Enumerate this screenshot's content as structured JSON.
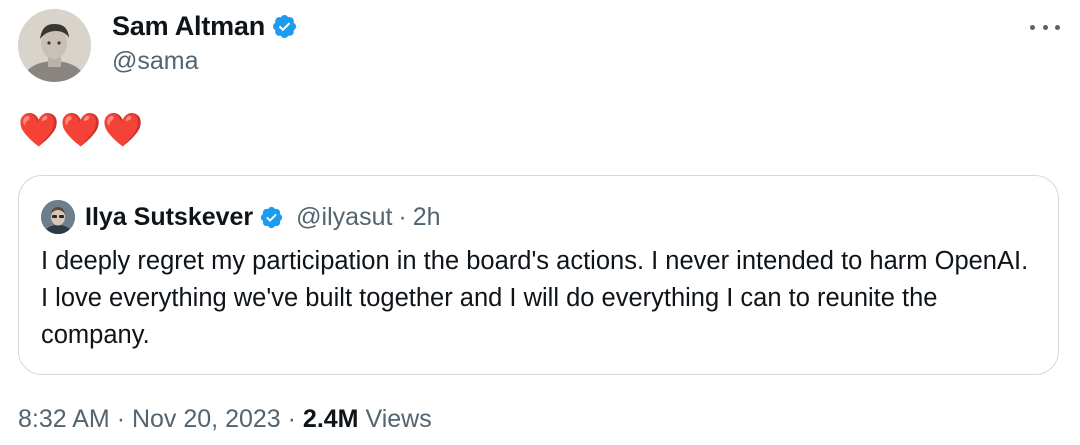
{
  "tweet": {
    "author": {
      "name": "Sam Altman",
      "handle": "@sama",
      "verified": true,
      "avatar": "profile-photo"
    },
    "text": "❤️❤️❤️",
    "more_icon": "ellipsis-horizontal-icon",
    "quote": {
      "author": {
        "name": "Ilya Sutskever",
        "handle": "@ilyasut",
        "verified": true,
        "avatar": "profile-photo"
      },
      "separator": "·",
      "time": "2h",
      "text": "I deeply regret my participation in the board's actions. I never intended to harm OpenAI. I love everything we've built together and I will do everything I can to reunite the company."
    },
    "meta": {
      "time": "8:32 AM",
      "separator": "·",
      "date": "Nov 20, 2023",
      "views_count": "2.4M",
      "views_label": "Views"
    }
  },
  "colors": {
    "text_primary": "#0f1419",
    "text_secondary": "#536471",
    "verified_blue": "#1d9bf0",
    "border": "#cfd9de",
    "heart_red": "#e0245e"
  }
}
